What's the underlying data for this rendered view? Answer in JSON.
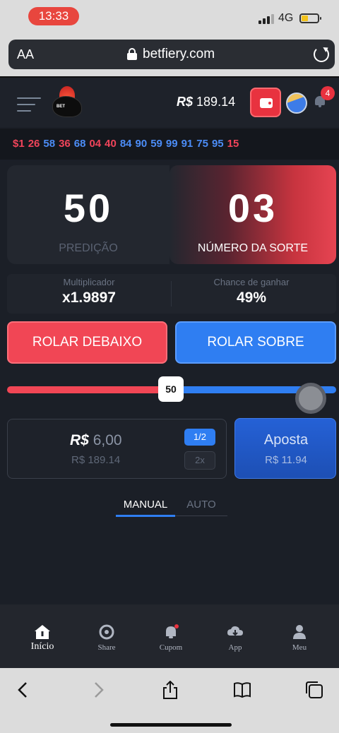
{
  "status_bar": {
    "time": "13:33",
    "network": "4G"
  },
  "browser": {
    "text_size_label": "AA",
    "url": "betfiery.com"
  },
  "header": {
    "balance_currency": "R$",
    "balance_amount": "189.14",
    "notification_count": "4"
  },
  "recent_results": [
    {
      "value": "51",
      "shown": "$1",
      "color": "red"
    },
    {
      "value": "26",
      "shown": "26",
      "color": "red"
    },
    {
      "value": "58",
      "shown": "58",
      "color": "blue"
    },
    {
      "value": "36",
      "shown": "36",
      "color": "red"
    },
    {
      "value": "68",
      "shown": "68",
      "color": "blue"
    },
    {
      "value": "04",
      "shown": "04",
      "color": "red"
    },
    {
      "value": "40",
      "shown": "40",
      "color": "red"
    },
    {
      "value": "84",
      "shown": "84",
      "color": "blue"
    },
    {
      "value": "90",
      "shown": "90",
      "color": "blue"
    },
    {
      "value": "59",
      "shown": "59",
      "color": "blue"
    },
    {
      "value": "99",
      "shown": "99",
      "color": "blue"
    },
    {
      "value": "91",
      "shown": "91",
      "color": "blue"
    },
    {
      "value": "75",
      "shown": "75",
      "color": "blue"
    },
    {
      "value": "95",
      "shown": "95",
      "color": "blue"
    },
    {
      "value": "15",
      "shown": "15",
      "color": "red"
    }
  ],
  "game": {
    "prediction_value": "50",
    "prediction_label": "PREDIÇÃO",
    "lucky_value": "03",
    "lucky_label": "NÚMERO DA SORTE",
    "multiplier_label": "Multiplicador",
    "multiplier_value": "x1.9897",
    "chance_label": "Chance de ganhar",
    "chance_value": "49%",
    "roll_under_label": "ROLAR DEBAIXO",
    "roll_over_label": "ROLAR SOBRE",
    "slider_value": "50",
    "slider_fraction": 0.5
  },
  "bet": {
    "currency": "R$",
    "amount": "6,00",
    "balance": "R$ 189.14",
    "half_label": "1/2",
    "double_label": "2x",
    "apply_label": "Aposta",
    "apply_value": "R$ 11.94"
  },
  "mode_tabs": {
    "manual": "MANUAL",
    "auto": "AUTO",
    "active": "manual"
  },
  "bottom_nav": [
    {
      "label": "Início",
      "icon": "home-icon",
      "active": true
    },
    {
      "label": "Share",
      "icon": "share-icon",
      "active": false
    },
    {
      "label": "Cupom",
      "icon": "bell-icon",
      "active": false
    },
    {
      "label": "App",
      "icon": "download-icon",
      "active": false
    },
    {
      "label": "Meu",
      "icon": "user-icon",
      "active": false
    }
  ],
  "colors": {
    "red": "#f14655",
    "blue": "#2f7ef2",
    "background": "#1b1f27"
  }
}
